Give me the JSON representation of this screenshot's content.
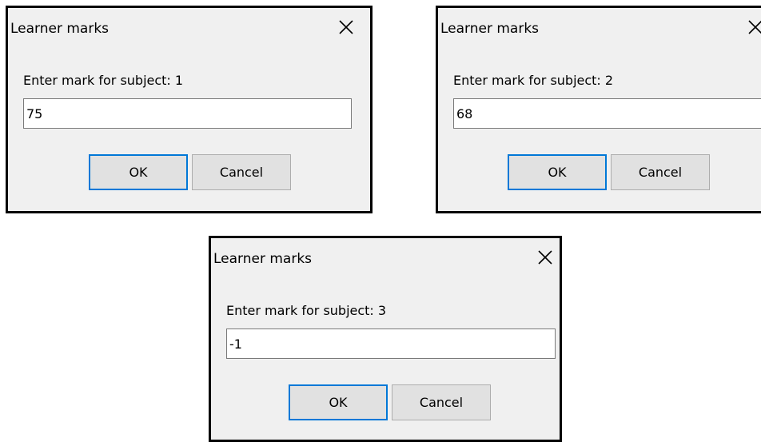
{
  "dialogs": [
    {
      "title": "Learner marks",
      "prompt": "Enter mark for subject: 1",
      "input_value": "75",
      "ok_label": "OK",
      "cancel_label": "Cancel",
      "close_icon": "close-icon"
    },
    {
      "title": "Learner marks",
      "prompt": "Enter mark for subject: 2",
      "input_value": "68",
      "ok_label": "OK",
      "cancel_label": "Cancel",
      "close_icon": "close-icon"
    },
    {
      "title": "Learner marks",
      "prompt": "Enter mark for subject: 3",
      "input_value": "-1",
      "ok_label": "OK",
      "cancel_label": "Cancel",
      "close_icon": "close-icon"
    }
  ],
  "colors": {
    "dialog_background": "#f0f0f0",
    "dialog_border": "#000000",
    "input_background": "#ffffff",
    "button_background": "#e1e1e1",
    "default_button_accent": "#0078d7"
  }
}
